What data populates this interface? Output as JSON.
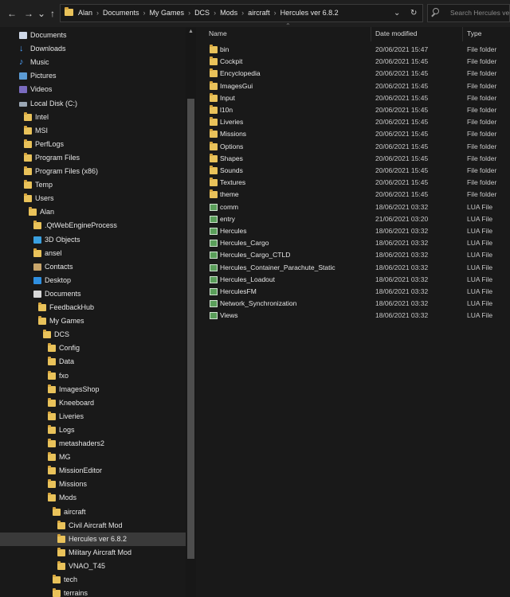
{
  "toolbar": {
    "back": "←",
    "forward": "→",
    "recent": "⌄",
    "up": "↑"
  },
  "address": {
    "crumbs": [
      "Alan",
      "Documents",
      "My Games",
      "DCS",
      "Mods",
      "aircraft",
      "Hercules ver 6.8.2"
    ],
    "separator": "›",
    "dropdown": "⌄",
    "refresh": "↻"
  },
  "search": {
    "placeholder": "Search Hercules ve"
  },
  "nav": {
    "items": [
      {
        "label": "Documents",
        "icon": "doc-icon",
        "indent": 24
      },
      {
        "label": "Downloads",
        "icon": "download-icon",
        "indent": 24
      },
      {
        "label": "Music",
        "icon": "music-icon",
        "indent": 24
      },
      {
        "label": "Pictures",
        "icon": "pictures-icon",
        "indent": 24
      },
      {
        "label": "Videos",
        "icon": "videos-icon",
        "indent": 24
      },
      {
        "label": "Local Disk (C:)",
        "icon": "disk-icon",
        "indent": 24
      },
      {
        "label": "Intel",
        "icon": "folder-icon",
        "indent": 30
      },
      {
        "label": "MSI",
        "icon": "folder-icon",
        "indent": 30
      },
      {
        "label": "PerfLogs",
        "icon": "folder-icon",
        "indent": 30
      },
      {
        "label": "Program Files",
        "icon": "folder-icon",
        "indent": 30
      },
      {
        "label": "Program Files (x86)",
        "icon": "folder-icon",
        "indent": 30
      },
      {
        "label": "Temp",
        "icon": "folder-icon",
        "indent": 30
      },
      {
        "label": "Users",
        "icon": "folder-icon",
        "indent": 30
      },
      {
        "label": "Alan",
        "icon": "folder-icon",
        "indent": 36
      },
      {
        "label": ".QtWebEngineProcess",
        "icon": "folder-icon",
        "indent": 42
      },
      {
        "label": "3D Objects",
        "icon": "cube-icon",
        "indent": 42
      },
      {
        "label": "ansel",
        "icon": "folder-icon",
        "indent": 42
      },
      {
        "label": "Contacts",
        "icon": "contacts-icon",
        "indent": 42
      },
      {
        "label": "Desktop",
        "icon": "desktop-icon",
        "indent": 42
      },
      {
        "label": "Documents",
        "icon": "documents-icon",
        "indent": 42
      },
      {
        "label": "FeedbackHub",
        "icon": "folder-icon",
        "indent": 48
      },
      {
        "label": "My Games",
        "icon": "folder-icon",
        "indent": 48
      },
      {
        "label": "DCS",
        "icon": "folder-icon",
        "indent": 54
      },
      {
        "label": "Config",
        "icon": "folder-icon",
        "indent": 60
      },
      {
        "label": "Data",
        "icon": "folder-icon",
        "indent": 60
      },
      {
        "label": "fxo",
        "icon": "folder-icon",
        "indent": 60
      },
      {
        "label": "ImagesShop",
        "icon": "folder-icon",
        "indent": 60
      },
      {
        "label": "Kneeboard",
        "icon": "folder-icon",
        "indent": 60
      },
      {
        "label": "Liveries",
        "icon": "folder-icon",
        "indent": 60
      },
      {
        "label": "Logs",
        "icon": "folder-icon",
        "indent": 60
      },
      {
        "label": "metashaders2",
        "icon": "folder-icon",
        "indent": 60
      },
      {
        "label": "MG",
        "icon": "folder-icon",
        "indent": 60
      },
      {
        "label": "MissionEditor",
        "icon": "folder-icon",
        "indent": 60
      },
      {
        "label": "Missions",
        "icon": "folder-icon",
        "indent": 60
      },
      {
        "label": "Mods",
        "icon": "folder-icon",
        "indent": 60
      },
      {
        "label": "aircraft",
        "icon": "folder-icon",
        "indent": 66
      },
      {
        "label": "Civil Aircraft Mod",
        "icon": "folder-icon",
        "indent": 72
      },
      {
        "label": "Hercules ver 6.8.2",
        "icon": "folder-icon",
        "indent": 72,
        "selected": true
      },
      {
        "label": "Military Aircraft Mod",
        "icon": "folder-icon",
        "indent": 72
      },
      {
        "label": "VNAO_T45",
        "icon": "folder-icon",
        "indent": 72
      },
      {
        "label": "tech",
        "icon": "folder-icon",
        "indent": 66
      },
      {
        "label": "terrains",
        "icon": "folder-icon",
        "indent": 66
      }
    ]
  },
  "columns": {
    "name": "Name",
    "date": "Date modified",
    "type": "Type"
  },
  "files": [
    {
      "name": "bin",
      "date": "20/06/2021 15:47",
      "type": "File folder",
      "kind": "folder"
    },
    {
      "name": "Cockpit",
      "date": "20/06/2021 15:45",
      "type": "File folder",
      "kind": "folder"
    },
    {
      "name": "Encyclopedia",
      "date": "20/06/2021 15:45",
      "type": "File folder",
      "kind": "folder"
    },
    {
      "name": "ImagesGui",
      "date": "20/06/2021 15:45",
      "type": "File folder",
      "kind": "folder"
    },
    {
      "name": "Input",
      "date": "20/06/2021 15:45",
      "type": "File folder",
      "kind": "folder"
    },
    {
      "name": "l10n",
      "date": "20/06/2021 15:45",
      "type": "File folder",
      "kind": "folder"
    },
    {
      "name": "Liveries",
      "date": "20/06/2021 15:45",
      "type": "File folder",
      "kind": "folder"
    },
    {
      "name": "Missions",
      "date": "20/06/2021 15:45",
      "type": "File folder",
      "kind": "folder"
    },
    {
      "name": "Options",
      "date": "20/06/2021 15:45",
      "type": "File folder",
      "kind": "folder"
    },
    {
      "name": "Shapes",
      "date": "20/06/2021 15:45",
      "type": "File folder",
      "kind": "folder"
    },
    {
      "name": "Sounds",
      "date": "20/06/2021 15:45",
      "type": "File folder",
      "kind": "folder"
    },
    {
      "name": "Textures",
      "date": "20/06/2021 15:45",
      "type": "File folder",
      "kind": "folder"
    },
    {
      "name": "theme",
      "date": "20/06/2021 15:45",
      "type": "File folder",
      "kind": "folder"
    },
    {
      "name": "comm",
      "date": "18/06/2021 03:32",
      "type": "LUA File",
      "kind": "lua"
    },
    {
      "name": "entry",
      "date": "21/06/2021 03:20",
      "type": "LUA File",
      "kind": "lua"
    },
    {
      "name": "Hercules",
      "date": "18/06/2021 03:32",
      "type": "LUA File",
      "kind": "lua"
    },
    {
      "name": "Hercules_Cargo",
      "date": "18/06/2021 03:32",
      "type": "LUA File",
      "kind": "lua"
    },
    {
      "name": "Hercules_Cargo_CTLD",
      "date": "18/06/2021 03:32",
      "type": "LUA File",
      "kind": "lua"
    },
    {
      "name": "Hercules_Container_Parachute_Static",
      "date": "18/06/2021 03:32",
      "type": "LUA File",
      "kind": "lua"
    },
    {
      "name": "Hercules_Loadout",
      "date": "18/06/2021 03:32",
      "type": "LUA File",
      "kind": "lua"
    },
    {
      "name": "HerculesFM",
      "date": "18/06/2021 03:32",
      "type": "LUA File",
      "kind": "lua"
    },
    {
      "name": "Network_Synchronization",
      "date": "18/06/2021 03:32",
      "type": "LUA File",
      "kind": "lua"
    },
    {
      "name": "Views",
      "date": "18/06/2021 03:32",
      "type": "LUA File",
      "kind": "lua"
    }
  ],
  "colors": {
    "background": "#191919",
    "folder": "#e9c25a",
    "selected": "#3a3a3a",
    "accent": "#4da3ff"
  }
}
